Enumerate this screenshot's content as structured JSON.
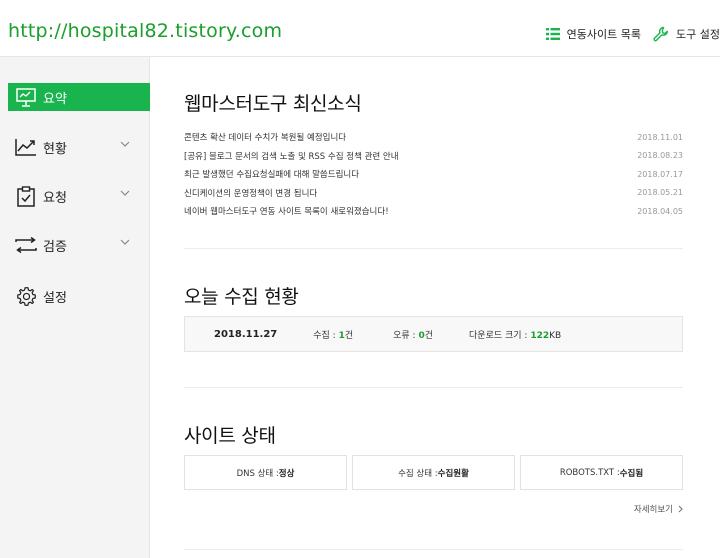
{
  "header": {
    "site_url": "http://hospital82.tistory.com",
    "linked_sites_label": "연동사이트 목록",
    "tool_settings_label": "도구 설정"
  },
  "sidebar": {
    "items": [
      {
        "label": "요약",
        "icon": "monitor-icon",
        "active": true
      },
      {
        "label": "현황",
        "icon": "trend-chart-icon",
        "expandable": true
      },
      {
        "label": "요청",
        "icon": "clipboard-check-icon",
        "expandable": true
      },
      {
        "label": "검증",
        "icon": "swap-arrows-icon",
        "expandable": true
      },
      {
        "label": "설정",
        "icon": "gear-icon"
      }
    ]
  },
  "news": {
    "title": "웹마스터도구 최신소식",
    "items": [
      {
        "title": "콘텐츠 확산 데이터 수치가 복원될 예정입니다",
        "date": "2018.11.01"
      },
      {
        "title": "[공유] 블로그 문서의 검색 노출 및 RSS 수집 정책 관련 안내",
        "date": "2018.08.23"
      },
      {
        "title": "최근 발생했던 수집요청실패에 대해 말씀드립니다",
        "date": "2018.07.17"
      },
      {
        "title": "신디케이션의 운영정책이 변경 됩니다",
        "date": "2018.05.21"
      },
      {
        "title": "네이버 웹마스터도구 연동 사이트 목록이 새로워졌습니다!",
        "date": "2018.04.05"
      }
    ]
  },
  "today": {
    "title": "오늘 수집 현황",
    "date": "2018.11.27",
    "collect_label": "수집 : ",
    "collect_value": "1",
    "collect_unit": "건",
    "error_label": "오류 : ",
    "error_value": "0",
    "error_unit": "건",
    "download_label": "다운로드 크기 : ",
    "download_value": "122",
    "download_unit": "KB"
  },
  "site_status": {
    "title": "사이트 상태",
    "dns_label": "DNS 상태 : ",
    "dns_value": "정상",
    "collect_label": "수집 상태 : ",
    "collect_value": "수집원활",
    "robots_label": "ROBOTS.TXT : ",
    "robots_value": "수집됨",
    "more_label": "자세히보기"
  },
  "colors": {
    "accent": "#19b44e",
    "url_green": "#1a9e2c",
    "sidebar_bg": "#f4f4f4"
  }
}
